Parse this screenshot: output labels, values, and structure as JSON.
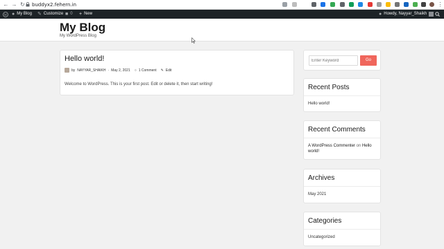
{
  "browser": {
    "url": "buddyx2.fehern.in",
    "colors": {
      "toolbar": "#ffffff",
      "text": "#202124"
    }
  },
  "adminbar": {
    "wp_logo": "wordpress-icon",
    "site_name": "My Blog",
    "customize": "Customize",
    "comments_count": "0",
    "new": "New",
    "howdy": "Howdy, Nayyar_Shaikh",
    "colors": {
      "background": "#1d2327",
      "text": "#f0f0f1"
    }
  },
  "site": {
    "title": "My Blog",
    "description": "My WordPress Blog"
  },
  "post": {
    "title": "Hello world!",
    "by": "by",
    "author": "NAYYAR_SHAIKH",
    "date": "May 2, 2021",
    "comments": "1 Comment",
    "edit": "Edit",
    "content": "Welcome to WordPress. This is your first post. Edit or delete it, then start writing!"
  },
  "sidebar": {
    "search": {
      "placeholder": "Enter Keyword",
      "button": "Go",
      "button_color": "#f0665c"
    },
    "recent_posts": {
      "title": "Recent Posts",
      "items": [
        "Hello world!"
      ]
    },
    "recent_comments": {
      "title": "Recent Comments",
      "author": "A WordPress Commenter",
      "on": "on",
      "post": "Hello world!"
    },
    "archives": {
      "title": "Archives",
      "items": [
        "May 2021"
      ]
    },
    "categories": {
      "title": "Categories",
      "items": [
        "Uncategorized"
      ]
    }
  }
}
